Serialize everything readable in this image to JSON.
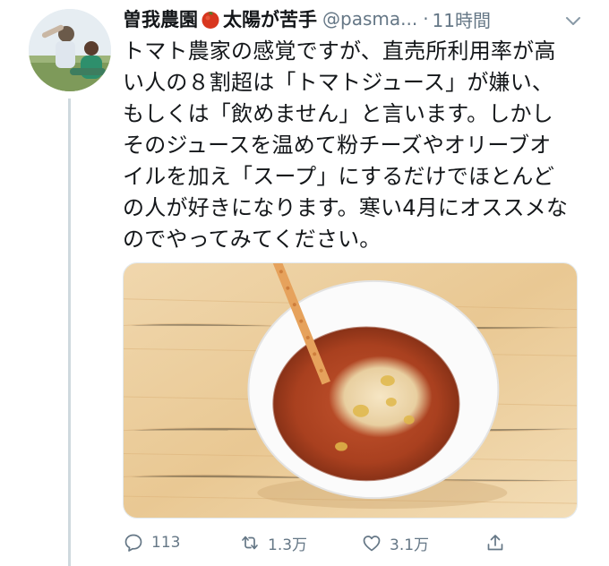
{
  "tweet": {
    "display_name_part1": "曽我農園",
    "display_name_part2": "太陽が苦手",
    "name_emoji": "tomato-icon",
    "handle": "@pasma...",
    "separator": "·",
    "timestamp": "11時間",
    "text_lines": [
      "トマト農家の感覚ですが、直売所利用率が高",
      "い人の８割超は「トマトジュース」が嫌い、",
      "もしくは「飲めません」と言います。しかし",
      "そのジュースを温めて粉チーズやオリーブオ",
      "イルを加え「スープ」にするだけでほとんど",
      "の人が好きになります。寒い4月にオススメな",
      "のでやってみてください。"
    ]
  },
  "actions": {
    "reply_count": "113",
    "retweet_count": "1.3万",
    "like_count": "3.1万"
  },
  "colors": {
    "text": "#14171a",
    "muted": "#657786",
    "thread_line": "#cfd9de"
  }
}
